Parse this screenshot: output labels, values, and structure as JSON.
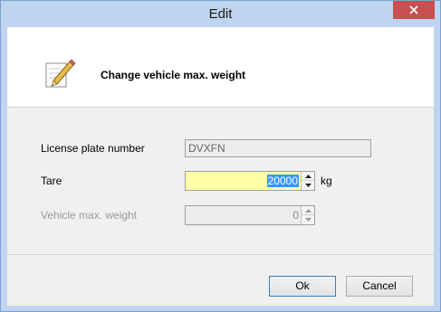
{
  "window": {
    "title": "Edit",
    "close_icon": "close-icon"
  },
  "header": {
    "icon": "pencil-icon",
    "text": "Change vehicle max. weight"
  },
  "form": {
    "license_plate": {
      "label": "License plate number",
      "value": "DVXFN",
      "enabled": false
    },
    "tare": {
      "label": "Tare",
      "value": "20000",
      "unit": "kg",
      "enabled": true,
      "highlight_color": "#ffffa8"
    },
    "max_weight": {
      "label": "Vehicle max. weight",
      "value": "0",
      "enabled": false
    }
  },
  "footer": {
    "ok_label": "Ok",
    "cancel_label": "Cancel"
  },
  "colors": {
    "titlebar": "#bfd4ee",
    "close_button": "#c75050",
    "selection": "#3399ff"
  }
}
